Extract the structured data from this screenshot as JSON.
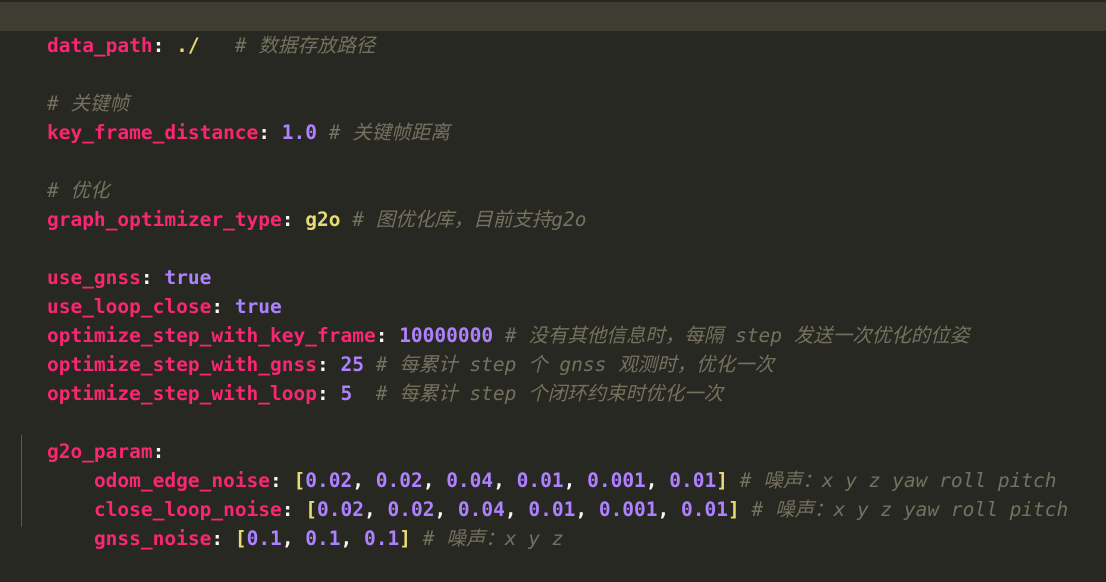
{
  "colors": {
    "background": "#272822",
    "current_line": "#3e3d32",
    "key": "#f92672",
    "number": "#ae81ff",
    "string": "#e6db74",
    "comment": "#75715e",
    "punctuation": "#f8f8f2"
  },
  "lines": {
    "l1": {
      "key": "data_path",
      "value": "./",
      "comment": "# 数据存放路径"
    },
    "l3": {
      "comment": "# 关键帧"
    },
    "l4": {
      "key": "key_frame_distance",
      "value": "1.0",
      "comment": "# 关键帧距离"
    },
    "l6": {
      "comment": "# 优化"
    },
    "l7": {
      "key": "graph_optimizer_type",
      "value": "g2o",
      "comment": "# 图优化库，目前支持g2o"
    },
    "l9": {
      "key": "use_gnss",
      "value": "true"
    },
    "l10": {
      "key": "use_loop_close",
      "value": "true"
    },
    "l11": {
      "key": "optimize_step_with_key_frame",
      "value": "10000000",
      "comment": "# 没有其他信息时，每隔 step 发送一次优化的位姿"
    },
    "l12": {
      "key": "optimize_step_with_gnss",
      "value": "25",
      "comment": "# 每累计 step 个 gnss 观测时，优化一次"
    },
    "l13": {
      "key": "optimize_step_with_loop",
      "value": "5",
      "comment": "# 每累计 step 个闭环约束时优化一次"
    },
    "l15": {
      "key": "g2o_param"
    },
    "l16": {
      "key": "odom_edge_noise",
      "values": [
        "0.02",
        "0.02",
        "0.04",
        "0.01",
        "0.001",
        "0.01"
      ],
      "comment": "# 噪声：x y z yaw roll pitch"
    },
    "l17": {
      "key": "close_loop_noise",
      "values": [
        "0.02",
        "0.02",
        "0.04",
        "0.01",
        "0.001",
        "0.01"
      ],
      "comment": "# 噪声：x y z yaw roll pitch"
    },
    "l18": {
      "key": "gnss_noise",
      "values": [
        "0.1",
        "0.1",
        "0.1"
      ],
      "comment": "# 噪声：x y z"
    }
  }
}
